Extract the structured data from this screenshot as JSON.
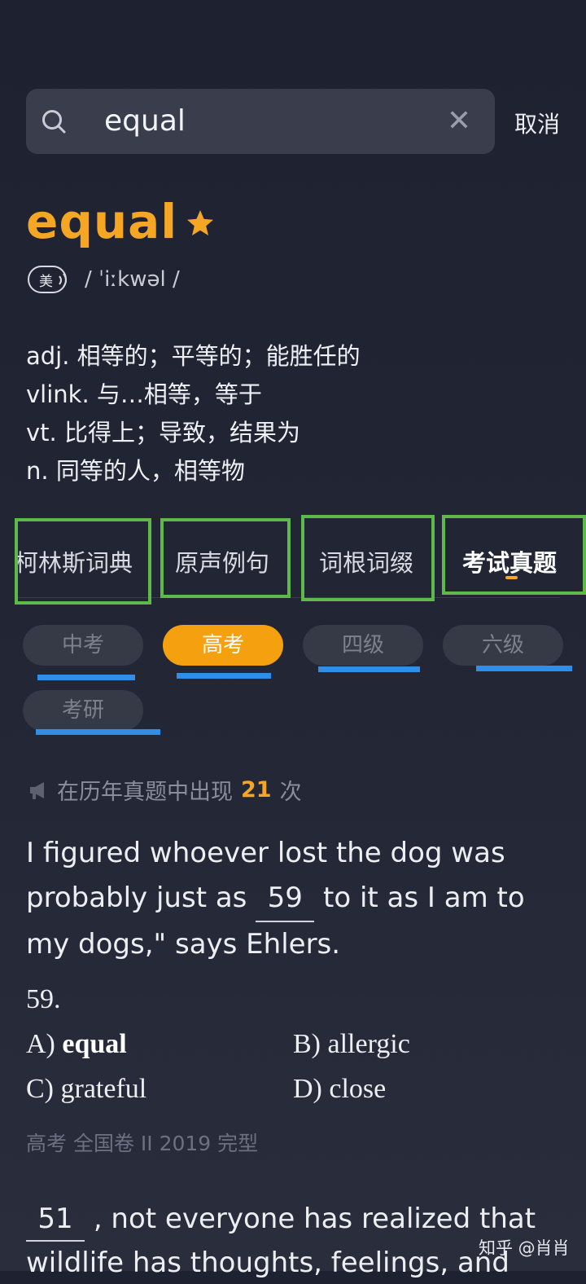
{
  "search": {
    "query": "equal",
    "clear_symbol": "✕",
    "cancel_label": "取消"
  },
  "entry": {
    "word": "equal",
    "accent_badge": "美",
    "phonetic": "/ ˈiːkwəl /",
    "definitions": [
      "adj. 相等的；平等的；能胜任的",
      "vlink. 与…相等，等于",
      "vt. 比得上；导致，结果为",
      "n. 同等的人，相等物"
    ]
  },
  "tabs": [
    {
      "label": "柯林斯词典",
      "active": false
    },
    {
      "label": "原声例句",
      "active": false
    },
    {
      "label": "词根词缀",
      "active": false
    },
    {
      "label": "考试真题",
      "active": true
    }
  ],
  "exam_chips": [
    {
      "label": "中考",
      "active": false
    },
    {
      "label": "高考",
      "active": true
    },
    {
      "label": "四级",
      "active": false
    },
    {
      "label": "六级",
      "active": false
    },
    {
      "label": "考研",
      "active": false
    }
  ],
  "occurrence": {
    "prefix": "在历年真题中出现",
    "count": "21",
    "suffix": "次"
  },
  "question1": {
    "text_before": "I figured whoever lost the dog was probably just as",
    "blank": "59",
    "text_after": "to it as I am to my dogs,\" says Ehlers.",
    "number": "59.",
    "options": [
      {
        "letter": "A)",
        "text": "equal"
      },
      {
        "letter": "B)",
        "text": "allergic"
      },
      {
        "letter": "C)",
        "text": "grateful"
      },
      {
        "letter": "D)",
        "text": "close"
      }
    ],
    "source": "高考 全国卷 II 2019 完型"
  },
  "question2": {
    "blank": "51",
    "text_after": ", not everyone has realized that wildlife has thoughts, feelings, and"
  },
  "watermark": "知乎 @肖肖",
  "colors": {
    "accent": "#f5a623",
    "annotation_green": "#5fb84a",
    "annotation_blue": "#2f8fe8",
    "background": "#1e2230"
  }
}
